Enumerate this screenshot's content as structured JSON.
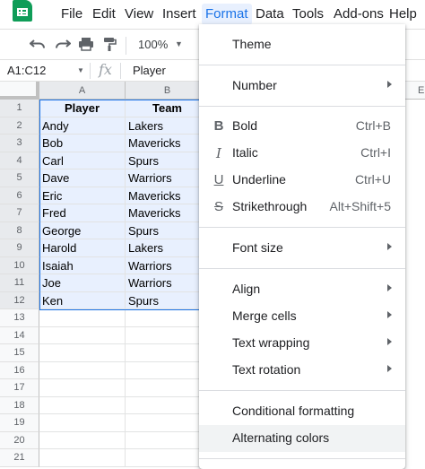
{
  "menubar": {
    "items": [
      {
        "label": "File"
      },
      {
        "label": "Edit"
      },
      {
        "label": "View"
      },
      {
        "label": "Insert"
      },
      {
        "label": "Format"
      },
      {
        "label": "Data"
      },
      {
        "label": "Tools"
      },
      {
        "label": "Add-ons"
      },
      {
        "label": "Help"
      }
    ],
    "active": "Format"
  },
  "toolbar": {
    "icons": [
      "undo-icon",
      "redo-icon",
      "print-icon",
      "paint-format-icon"
    ],
    "zoom": "100%"
  },
  "formula_bar": {
    "name_box": "A1:C12",
    "fx": "fx",
    "value": "Player"
  },
  "sheet": {
    "columns": [
      "A",
      "B"
    ],
    "far_column": "E",
    "rows": [
      "1",
      "2",
      "3",
      "4",
      "5",
      "6",
      "7",
      "8",
      "9",
      "10",
      "11",
      "12",
      "13",
      "14",
      "15",
      "16",
      "17",
      "18",
      "19",
      "20",
      "21"
    ],
    "cells": [
      [
        "Player",
        "Team"
      ],
      [
        "Andy",
        "Lakers"
      ],
      [
        "Bob",
        "Mavericks"
      ],
      [
        "Carl",
        "Spurs"
      ],
      [
        "Dave",
        "Warriors"
      ],
      [
        "Eric",
        "Mavericks"
      ],
      [
        "Fred",
        "Mavericks"
      ],
      [
        "George",
        "Spurs"
      ],
      [
        "Harold",
        "Lakers"
      ],
      [
        "Isaiah",
        "Warriors"
      ],
      [
        "Joe",
        "Warriors"
      ],
      [
        "Ken",
        "Spurs"
      ]
    ]
  },
  "format_menu": {
    "theme": "Theme",
    "number": "Number",
    "bold": {
      "label": "Bold",
      "shortcut": "Ctrl+B",
      "icon": "B"
    },
    "italic": {
      "label": "Italic",
      "shortcut": "Ctrl+I",
      "icon": "I"
    },
    "underline": {
      "label": "Underline",
      "shortcut": "Ctrl+U",
      "icon": "U"
    },
    "strikethrough": {
      "label": "Strikethrough",
      "shortcut": "Alt+Shift+5",
      "icon": "S"
    },
    "font_size": "Font size",
    "align": "Align",
    "merge_cells": "Merge cells",
    "text_wrapping": "Text wrapping",
    "text_rotation": "Text rotation",
    "conditional_formatting": "Conditional formatting",
    "alternating_colors": "Alternating colors"
  },
  "colors": {
    "accent": "#1a73e8",
    "selection_fill": "#e8f0fe",
    "sheets_green": "#0f9d58"
  }
}
